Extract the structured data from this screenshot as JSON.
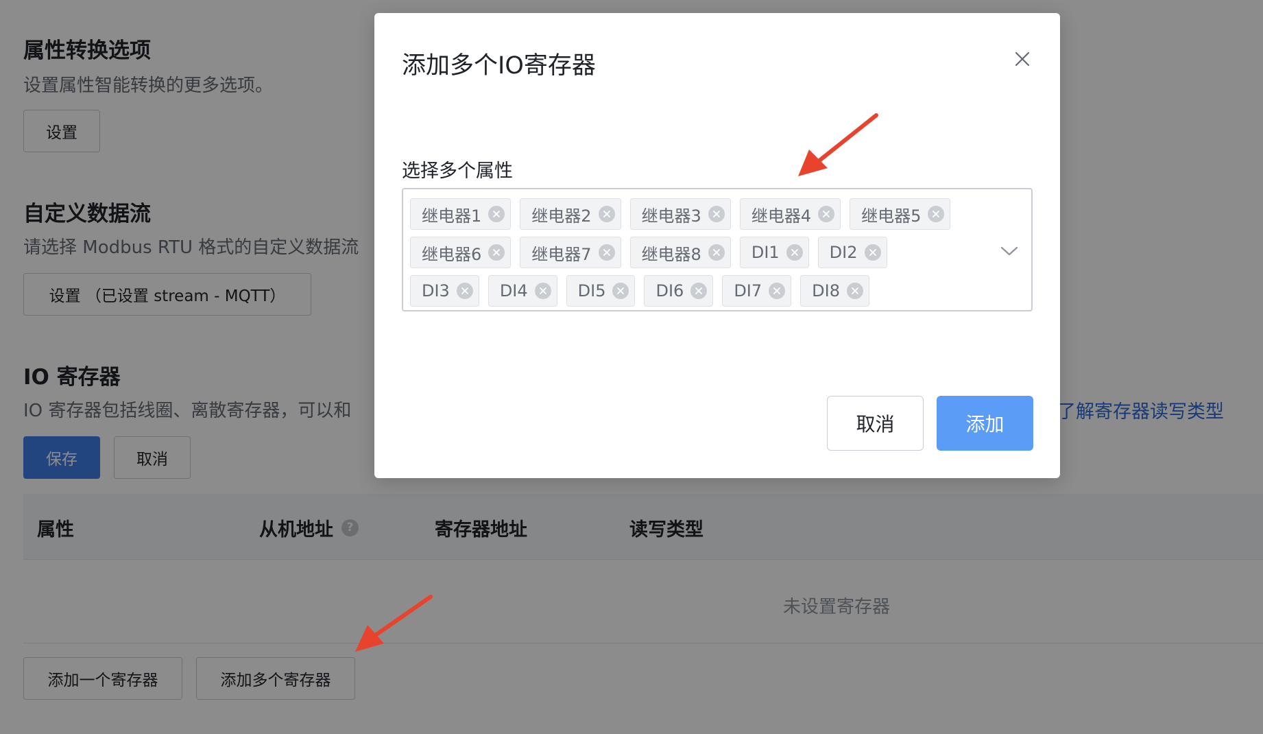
{
  "page": {
    "attr_section": {
      "title": "属性转换选项",
      "desc": "设置属性智能转换的更多选项。",
      "button": "设置"
    },
    "stream_section": {
      "title": "自定义数据流",
      "desc": "请选择 Modbus RTU 格式的自定义数据流",
      "button": "设置 （已设置 stream - MQTT）"
    },
    "io_section": {
      "title": "IO 寄存器",
      "desc": "IO 寄存器包括线圈、离散寄存器，可以和",
      "doc_link": "了解寄存器读写类型",
      "save_button": "保存",
      "cancel_button": "取消"
    },
    "table": {
      "columns": [
        "属性",
        "从机地址",
        "寄存器地址",
        "读写类型"
      ],
      "help_icon": "?",
      "empty_text": "未设置寄存器"
    },
    "footer": {
      "add_one_button": "添加一个寄存器",
      "add_multi_button": "添加多个寄存器"
    }
  },
  "modal": {
    "title": "添加多个IO寄存器",
    "field_label": "选择多个属性",
    "selected_rows": [
      [
        "继电器1",
        "继电器2",
        "继电器3",
        "继电器4",
        "继电器5"
      ],
      [
        "继电器6",
        "继电器7",
        "继电器8",
        "DI1",
        "DI2"
      ],
      [
        "DI3",
        "DI4",
        "DI5",
        "DI6",
        "DI7",
        "DI8"
      ]
    ],
    "cancel_button": "取消",
    "confirm_button": "添加"
  },
  "colors": {
    "primary": "#3f7ee8",
    "confirm": "#5b9cf6",
    "link": "#2f6bd8",
    "annotation_arrow": "#e8432d"
  },
  "icons": [
    "close-icon",
    "tag-remove-icon",
    "chevron-down-icon",
    "help-icon",
    "annotation-arrow"
  ]
}
